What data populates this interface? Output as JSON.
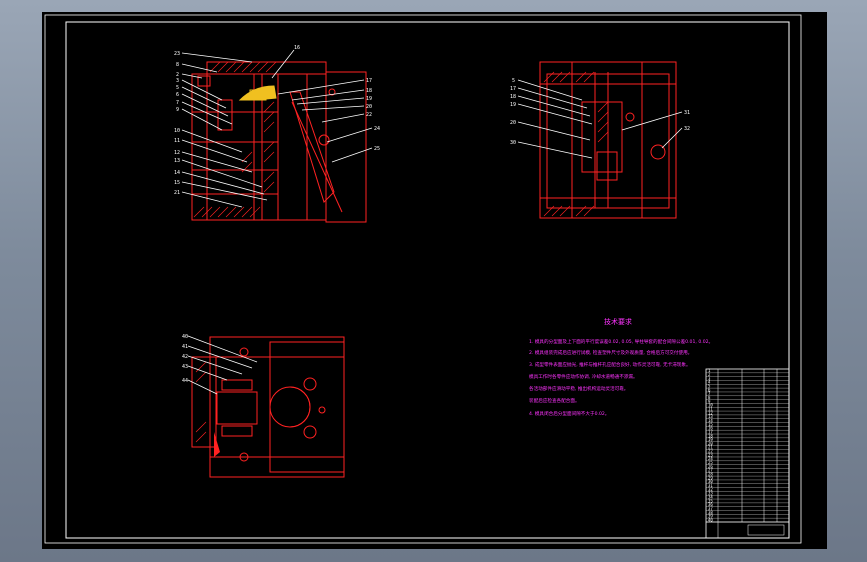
{
  "drawing": {
    "background": "#000000",
    "outline_color": "#ff2222",
    "leader_color": "#ffffff",
    "note_color": "#ff33ff",
    "accent_color": "#f0c020"
  },
  "tech_requirements": {
    "title": "技术要求",
    "lines": [
      "1. 模具的分型面及上下面的平行度误差0.02, 0.05, 导柱导套的配合间隙公差0.01, 0.02。",
      "2. 模具组装完成后应进行试模, 检查塑件尺寸及外观质量, 合格后方可交付使用。",
      "3. 成型零件表面应抛光, 推杆与推杆孔应配合良好, 动作灵活可靠, 无卡滞现象。",
      "   模具工作时各零件应动作协调, 冷却水道畅通不渗漏。",
      "   各活动部件应滑动平稳, 推出机构运动灵活可靠。",
      "   装配后应检查各配合面。",
      "4. 模具闭合后分型面间隙不大于0.02。"
    ]
  },
  "title_block": {
    "rows": [
      "1",
      "2",
      "3",
      "4",
      "5",
      "6",
      "7",
      "8",
      "9",
      "10",
      "11",
      "12",
      "13",
      "14",
      "15",
      "16",
      "17",
      "18",
      "19",
      "20",
      "21",
      "22",
      "23",
      "24",
      "25",
      "26",
      "27",
      "28",
      "29",
      "30",
      "31",
      "32",
      "33",
      "34",
      "35",
      "36",
      "37",
      "38",
      "39",
      "40"
    ]
  },
  "view_front": {
    "labels": [
      "23",
      "8",
      "2",
      "3",
      "5",
      "6",
      "7",
      "9",
      "10",
      "11",
      "12",
      "13",
      "14",
      "15",
      "21",
      "16",
      "17",
      "18",
      "19",
      "20",
      "22",
      "24",
      "25",
      "26"
    ]
  },
  "view_side": {
    "labels": [
      "5",
      "17",
      "18",
      "19",
      "20",
      "30",
      "31",
      "32"
    ]
  },
  "view_plan": {
    "labels": [
      "40",
      "41",
      "42",
      "43",
      "44"
    ]
  }
}
